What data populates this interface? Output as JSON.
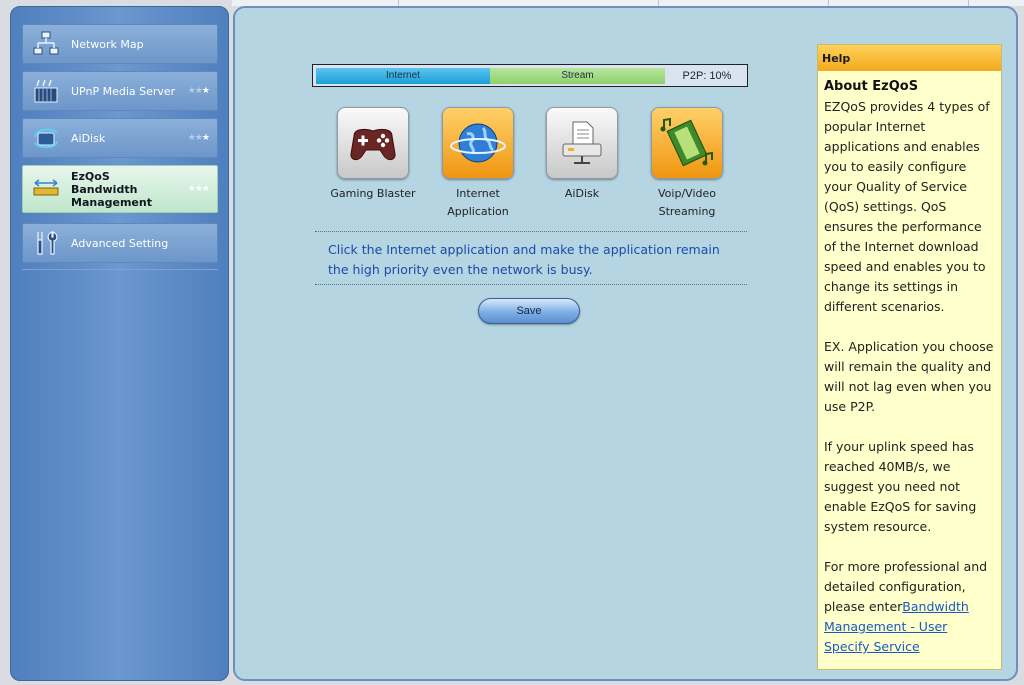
{
  "sidebar": {
    "items": [
      {
        "label": "Network Map",
        "icon": "network-map-icon",
        "stars": 0
      },
      {
        "label": "UPnP Media Server",
        "icon": "media-server-icon",
        "stars": 1
      },
      {
        "label": "AiDisk",
        "icon": "aidisk-icon",
        "stars": 1
      },
      {
        "label": "EzQoS Bandwidth Management",
        "icon": "ezqos-icon",
        "stars": 3,
        "active": true
      },
      {
        "label": "Advanced Setting",
        "icon": "wrench-icon",
        "stars": 0
      }
    ]
  },
  "bandwidth": {
    "internet_label": "Internet",
    "stream_label": "Stream",
    "p2p_label": "P2P: 10%",
    "p2p_percent": 10
  },
  "apps": [
    {
      "label": "Gaming Blaster",
      "icon": "gamepad-icon"
    },
    {
      "label": "Internet Application",
      "icon": "globe-icon"
    },
    {
      "label": "AiDisk",
      "icon": "printer-icon"
    },
    {
      "label": "Voip/Video Streaming",
      "icon": "film-music-icon"
    }
  ],
  "hint": "Click the Internet application and make the application remain the high priority even the network is busy.",
  "save_label": "Save",
  "help": {
    "header": "Help",
    "title": "About EzQoS",
    "p1": "EZQoS provides 4 types of popular Internet applications and enables you to easily configure your Quality of Service (QoS) settings. QoS ensures the performance of the Internet download speed and enables you to change its settings in different scenarios.",
    "p2": "EX. Application you choose will remain the quality and will not lag even when you use P2P.",
    "p3": "If your uplink speed has reached 40MB/s, we suggest you need not enable EzQoS for saving system resource.",
    "p4_prefix": "For more professional and detailed configuration, please enter",
    "p4_link": "Bandwidth Management - User Specify Service"
  },
  "colors": {
    "sidebar": "#5f8bc6",
    "main_bg": "#b5d5e3",
    "help_bg": "#ffffcc",
    "help_header": "#f5b32c",
    "hint_text": "#1d4aa8",
    "link": "#1a58c8"
  }
}
